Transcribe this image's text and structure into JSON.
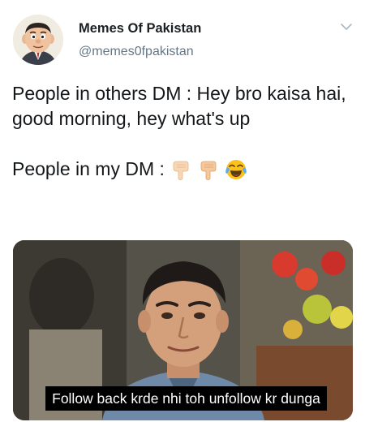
{
  "author": {
    "display_name": "Memes Of Pakistan",
    "handle": "@memes0fpakistan",
    "avatar_icon": "cartoon-face-avatar"
  },
  "menu": {
    "icon": "chevron-down-icon"
  },
  "tweet": {
    "line1": "People in others DM : Hey bro kaisa hai, good morning, hey what's up",
    "line2": "People in my DM :",
    "emojis": [
      "backhand-index-pointing-down",
      "backhand-index-pointing-down",
      "face-with-tears-of-joy"
    ]
  },
  "media": {
    "caption": "Follow back krde nhi toh unfollow kr dunga"
  },
  "colors": {
    "text": "#14171a",
    "handle": "#657786",
    "caption_bg": "#000000",
    "caption_text": "#ffffff"
  }
}
